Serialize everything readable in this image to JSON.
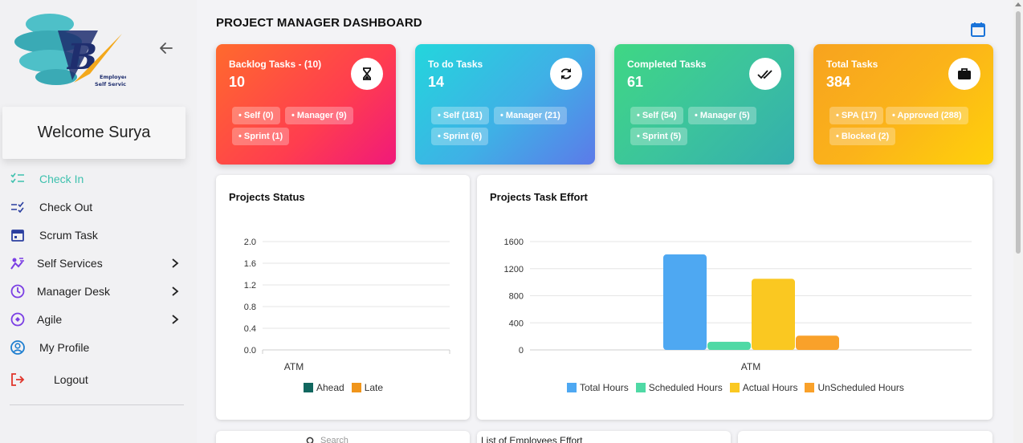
{
  "sidebar": {
    "logo_text": "Employee Self Services",
    "welcome": "Welcome Surya",
    "items": [
      {
        "label": "Check In",
        "icon": "checklist-icon"
      },
      {
        "label": "Check Out",
        "icon": "checklist-done-icon"
      },
      {
        "label": "Scrum Task",
        "icon": "calendar-icon"
      },
      {
        "label": "Self Services",
        "icon": "self-services-icon"
      },
      {
        "label": "Manager Desk",
        "icon": "manager-desk-icon"
      },
      {
        "label": "Agile",
        "icon": "agile-icon"
      },
      {
        "label": "My Profile",
        "icon": "profile-icon"
      },
      {
        "label": "Logout",
        "icon": "logout-icon"
      }
    ]
  },
  "header": {
    "title": "PROJECT MANAGER DASHBOARD"
  },
  "cards": [
    {
      "title": "Backlog Tasks - (10)",
      "value": "10",
      "icon": "hourglass-icon",
      "chips": [
        "• Self (0)",
        "• Manager (9)",
        "• Sprint (1)"
      ]
    },
    {
      "title": "To do Tasks",
      "value": "14",
      "icon": "refresh-icon",
      "chips": [
        "• Self (181)",
        "• Manager (21)",
        "• Sprint (6)"
      ]
    },
    {
      "title": "Completed Tasks",
      "value": "61",
      "icon": "double-check-icon",
      "chips": [
        "• Self (54)",
        "• Manager (5)",
        "• Sprint (5)"
      ]
    },
    {
      "title": "Total Tasks",
      "value": "384",
      "icon": "briefcase-icon",
      "chips": [
        "• SPA (17)",
        "• Approved (288)",
        "• Blocked (2)"
      ]
    }
  ],
  "panels": {
    "status_title": "Projects Status",
    "effort_title": "Projects Task Effort",
    "employees_effort_title": "List of Employees Effort",
    "search_placeholder": "Search"
  },
  "colors": {
    "active_nav": "#3ec1ae",
    "ahead": "#11675f",
    "late": "#f0951b",
    "total_hours": "#4ea8f2",
    "scheduled_hours": "#4fd9a5",
    "actual_hours": "#fac821",
    "unscheduled_hours": "#f9a12a"
  },
  "chart_data": [
    {
      "type": "bar",
      "title": "Projects Status",
      "categories": [
        "ATM"
      ],
      "series": [
        {
          "name": "Ahead",
          "values": [
            0
          ]
        },
        {
          "name": "Late",
          "values": [
            0
          ]
        }
      ],
      "yticks": [
        "2.0",
        "1.6",
        "1.2",
        "0.8",
        "0.4",
        "0.0"
      ],
      "ylim": [
        0,
        2.0
      ],
      "legend": "bottom",
      "grid": true
    },
    {
      "type": "bar",
      "title": "Projects Task Effort",
      "categories": [
        "ATM"
      ],
      "series": [
        {
          "name": "Total Hours",
          "values": [
            1410
          ]
        },
        {
          "name": "Scheduled Hours",
          "values": [
            120
          ]
        },
        {
          "name": "Actual Hours",
          "values": [
            1050
          ]
        },
        {
          "name": "UnScheduled Hours",
          "values": [
            210
          ]
        }
      ],
      "yticks": [
        "1600",
        "1200",
        "800",
        "400",
        "0"
      ],
      "ylim": [
        0,
        1600
      ],
      "legend": "bottom",
      "grid": true
    }
  ]
}
